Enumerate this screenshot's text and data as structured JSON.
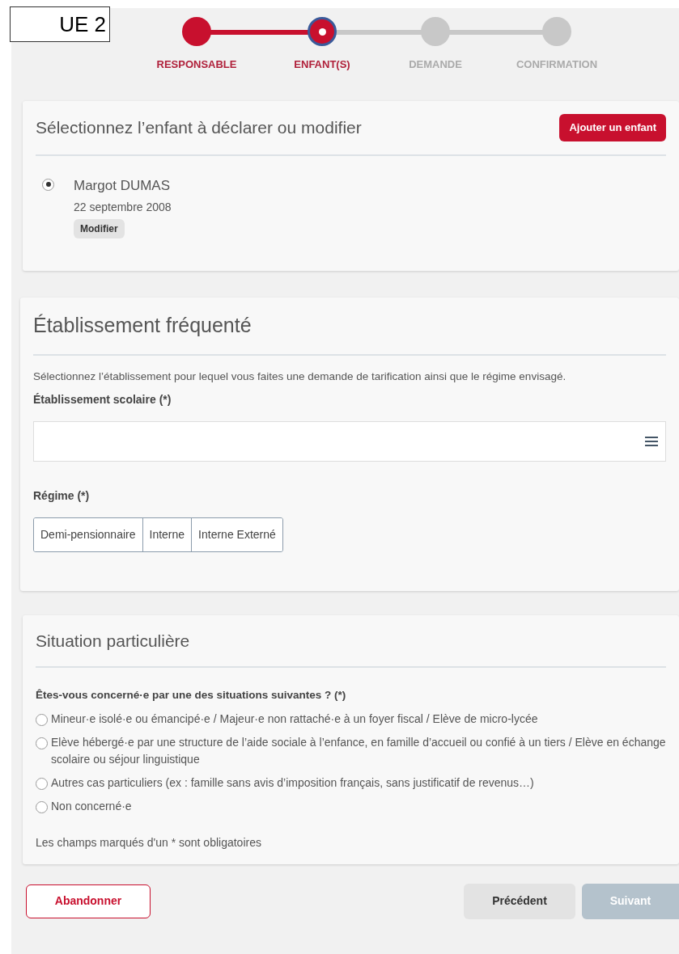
{
  "view_label": "UE 2",
  "steps": [
    {
      "label": "RESPONSABLE",
      "completed": true,
      "selected": false
    },
    {
      "label": "ENFANT(S)",
      "completed": false,
      "selected": true
    },
    {
      "label": "DEMANDE",
      "completed": false,
      "selected": false
    },
    {
      "label": "CONFIRMATION",
      "completed": false,
      "selected": false
    }
  ],
  "children_card": {
    "title": "Sélectionnez l’enfant à déclarer ou modifier",
    "add_button": "Ajouter un enfant",
    "children": [
      {
        "name": "Margot DUMAS",
        "birth_date": "22 septembre 2008",
        "edit_button": "Modifier",
        "selected": true
      }
    ]
  },
  "school_card": {
    "title": "Établissement fréquenté",
    "intro": "Sélectionnez l’établissement pour lequel vous faites une demande de tarification ainsi que le régime envisagé.",
    "school_label": "Établissement scolaire (*)",
    "regime_label": "Régime (*)",
    "regimes": [
      {
        "label": "Demi-pensionnaire",
        "selected": false
      },
      {
        "label": "Interne",
        "selected": false
      },
      {
        "label": "Interne Externé",
        "selected": false
      }
    ]
  },
  "situation_card": {
    "title": "Situation particulière",
    "question": "Êtes-vous concerné·e par une des situations suivantes ? (*)",
    "options": [
      {
        "label": "Mineur·e isolé·e ou émancipé·e / Majeur·e non rattaché·e à un foyer fiscal / Elève de micro-lycée",
        "selected": false
      },
      {
        "label": "Elève hébergé·e par une structure de l’aide sociale à l’enfance, en famille d’accueil ou confié à un tiers / Elève en échange scolaire ou séjour linguistique",
        "selected": false
      },
      {
        "label": "Autres cas particuliers (ex : famille sans avis d’imposition français, sans justificatif de revenus…)",
        "selected": false
      },
      {
        "label": "Non concerné·e",
        "selected": false
      }
    ],
    "footnote": "Les champs marqués d'un * sont obligatoires"
  },
  "footer": {
    "abandon": "Abandonner",
    "previous": "Précédent",
    "next": {
      "label": "Suivant",
      "disabled": true
    }
  }
}
